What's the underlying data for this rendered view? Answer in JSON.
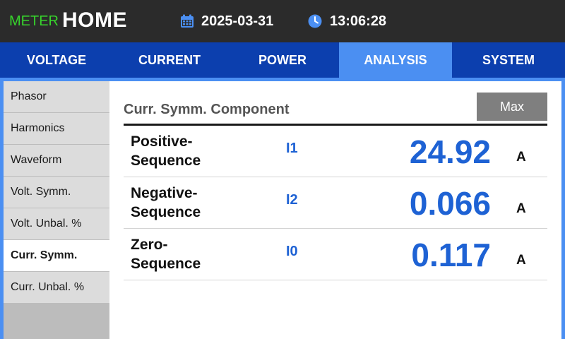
{
  "header": {
    "meter_label": "METER",
    "home_label": "HOME",
    "date": "2025-03-31",
    "time": "13:06:28",
    "date_icon": "calendar-icon",
    "time_icon": "clock-icon"
  },
  "tabs": [
    {
      "label": "VOLTAGE",
      "active": false
    },
    {
      "label": "CURRENT",
      "active": false
    },
    {
      "label": "POWER",
      "active": false
    },
    {
      "label": "ANALYSIS",
      "active": true
    },
    {
      "label": "SYSTEM",
      "active": false
    }
  ],
  "sidebar": {
    "items": [
      {
        "label": "Phasor",
        "active": false
      },
      {
        "label": "Harmonics",
        "active": false
      },
      {
        "label": "Waveform",
        "active": false
      },
      {
        "label": "Volt. Symm.",
        "active": false
      },
      {
        "label": "Volt. Unbal. %",
        "active": false
      },
      {
        "label": "Curr. Symm.",
        "active": true
      },
      {
        "label": "Curr. Unbal. %",
        "active": false
      }
    ]
  },
  "main": {
    "title": "Curr. Symm. Component",
    "max_button_label": "Max",
    "rows": [
      {
        "name_line1": "Positive-",
        "name_line2": "Sequence",
        "symbol": "I1",
        "value": "24.92",
        "unit": "A"
      },
      {
        "name_line1": "Negative-",
        "name_line2": "Sequence",
        "symbol": "I2",
        "value": "0.066",
        "unit": "A"
      },
      {
        "name_line1": "Zero-",
        "name_line2": "Sequence",
        "symbol": "I0",
        "value": "0.117",
        "unit": "A"
      }
    ]
  },
  "colors": {
    "header_bg": "#2b2b2b",
    "meter_green": "#37d42c",
    "tab_bar": "#0c3fae",
    "tab_active": "#4b8ff2",
    "value_blue": "#1e62d4",
    "max_button": "#7f7f7f"
  }
}
